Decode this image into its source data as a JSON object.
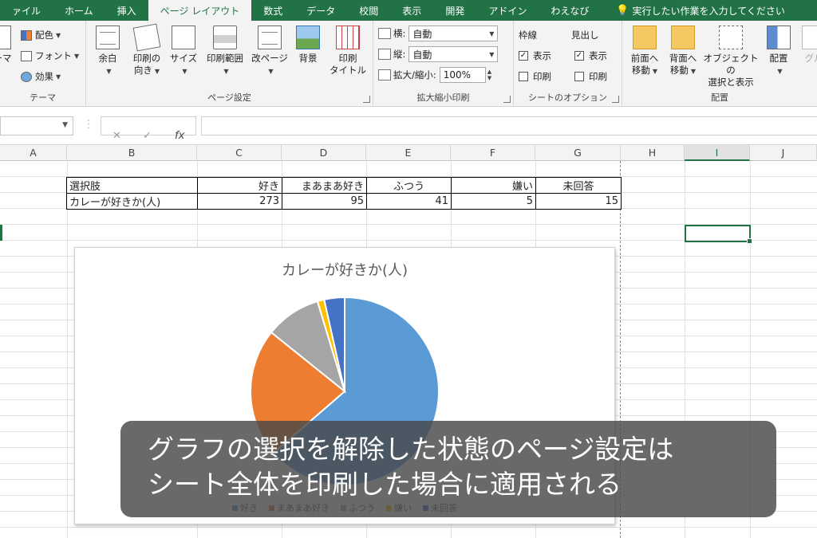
{
  "tabs": [
    {
      "label": "ァイル"
    },
    {
      "label": "ホーム"
    },
    {
      "label": "挿入"
    },
    {
      "label": "ページ レイアウト",
      "active": true
    },
    {
      "label": "数式"
    },
    {
      "label": "データ"
    },
    {
      "label": "校閲"
    },
    {
      "label": "表示"
    },
    {
      "label": "開発"
    },
    {
      "label": "アドイン"
    },
    {
      "label": "わえなび"
    }
  ],
  "tell_me": "実行したい作業を入力してください",
  "ribbon": {
    "theme": {
      "label": "テーマ",
      "theme_button": "ーマ",
      "colors": "配色",
      "fonts": "フォント",
      "effects": "効果"
    },
    "page_setup": {
      "label": "ページ設定",
      "margins": "余白",
      "orientation_1": "印刷の",
      "orientation_2": "向き",
      "size": "サイズ",
      "print_area": "印刷範囲",
      "breaks": "改ページ",
      "background": "背景",
      "print_titles_1": "印刷",
      "print_titles_2": "タイトル"
    },
    "scale": {
      "label": "拡大縮小印刷",
      "width_label": "横:",
      "width_value": "自動",
      "height_label": "縦:",
      "height_value": "自動",
      "scale_label": "拡大/縮小:",
      "scale_value": "100%"
    },
    "sheet_options": {
      "label": "シートのオプション",
      "gridlines": "枠線",
      "headings": "見出し",
      "view": "表示",
      "print": "印刷"
    },
    "arrange": {
      "label": "配置",
      "bring_forward_1": "前面へ",
      "bring_forward_2": "移動",
      "send_backward_1": "背面へ",
      "send_backward_2": "移動",
      "selection_pane_1": "オブジェクトの",
      "selection_pane_2": "選択と表示",
      "align": "配置",
      "group": "グル"
    }
  },
  "formula_bar": {
    "cancel": "✕",
    "enter": "✓",
    "fx": "fx"
  },
  "columns": [
    "A",
    "B",
    "C",
    "D",
    "E",
    "F",
    "G",
    "H",
    "I",
    "J"
  ],
  "table": {
    "headers": [
      "選択肢",
      "好き",
      "まあまあ好き",
      "ふつう",
      "嫌い",
      "未回答"
    ],
    "rows": [
      {
        "label": "カレーが好きか(人)",
        "values": [
          "273",
          "95",
          "41",
          "5",
          "15"
        ]
      }
    ]
  },
  "chart_data": {
    "type": "pie",
    "title": "カレーが好きか(人)",
    "categories": [
      "好き",
      "まあまあ好き",
      "ふつう",
      "嫌い",
      "未回答"
    ],
    "values": [
      273,
      95,
      41,
      5,
      15
    ],
    "colors": [
      "#5b9bd5",
      "#ed7d31",
      "#a5a5a5",
      "#ffc000",
      "#4472c4"
    ],
    "legend": "bottom"
  },
  "caption": {
    "line1": "グラフの選択を解除した状態のページ設定は",
    "line2": "シート全体を印刷した場合に適用される"
  }
}
